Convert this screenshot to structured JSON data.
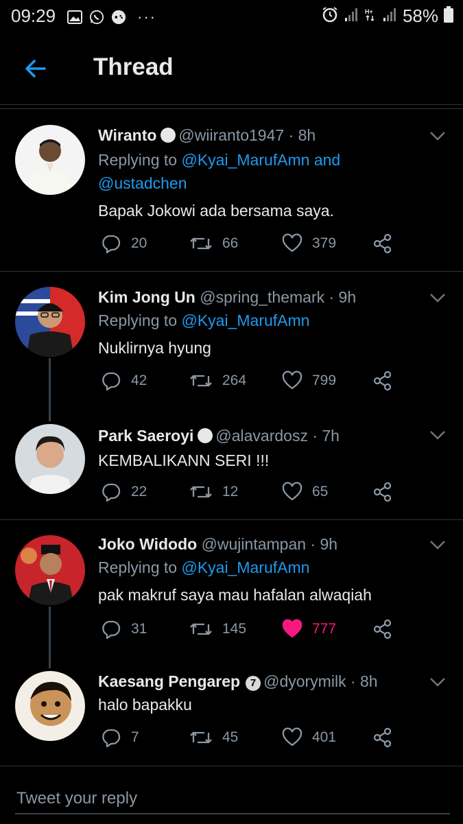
{
  "status_bar": {
    "time": "09:29",
    "dots": "···",
    "battery": "58%"
  },
  "header": {
    "title": "Thread"
  },
  "tweets": [
    {
      "name": "Wiranto",
      "handle": "@wiiranto1947",
      "time": "· 8h",
      "replying_prefix": "Replying to ",
      "replying_to": "@Kyai_MarufAmn and @ustadchen",
      "text": "Bapak Jokowi ada bersama saya.",
      "replies": "20",
      "retweets": "66",
      "likes": "379",
      "liked": false
    },
    {
      "name": "Kim Jong Un",
      "handle": "@spring_themark",
      "time": "· 9h",
      "replying_prefix": "Replying to ",
      "replying_to": "@Kyai_MarufAmn",
      "text": "Nuklirnya hyung",
      "replies": "42",
      "retweets": "264",
      "likes": "799",
      "liked": false
    },
    {
      "name": "Park Saeroyi",
      "handle": "@alavardosz",
      "time": "· 7h",
      "text": "KEMBALIKANN SERI !!!",
      "replies": "22",
      "retweets": "12",
      "likes": "65",
      "liked": false
    },
    {
      "name": "Joko Widodo",
      "handle": "@wujintampan",
      "time": "· 9h",
      "replying_prefix": "Replying to ",
      "replying_to": "@Kyai_MarufAmn",
      "text": "pak makruf saya mau hafalan alwaqiah",
      "replies": "31",
      "retweets": "145",
      "likes": "777",
      "liked": true
    },
    {
      "name": "Kaesang Pengarep",
      "badge": "7",
      "handle": "@dyorymilk",
      "time": "· 8h",
      "text": "halo bapakku",
      "replies": "7",
      "retweets": "45",
      "likes": "401",
      "liked": false
    }
  ],
  "reply": {
    "placeholder": "Tweet your reply"
  },
  "colors": {
    "background": "#000000",
    "accent": "#1d9bf0",
    "like": "#f91880",
    "muted": "#8b98a5"
  }
}
